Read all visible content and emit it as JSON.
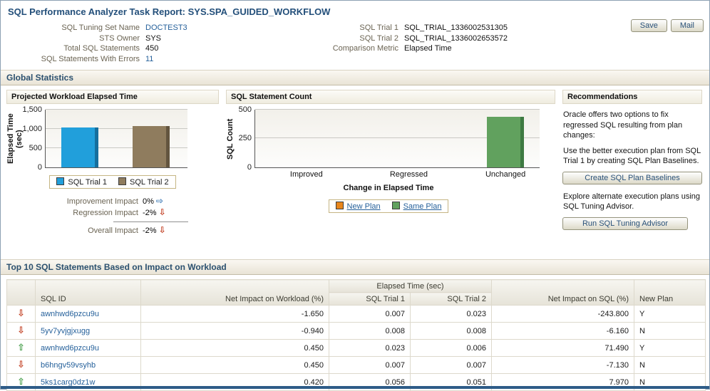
{
  "page": {
    "title": "SQL Performance Analyzer Task Report: SYS.SPA_GUIDED_WORKFLOW"
  },
  "toolbar": {
    "save": "Save",
    "mail": "Mail"
  },
  "summary": {
    "left": [
      {
        "label": "SQL Tuning Set Name",
        "value": "DOCTEST3"
      },
      {
        "label": "STS Owner",
        "value": "SYS"
      },
      {
        "label": "Total SQL Statements",
        "value": "450"
      },
      {
        "label": "SQL Statements With Errors",
        "value": "11"
      }
    ],
    "right": [
      {
        "label": "SQL Trial 1",
        "value": "SQL_TRIAL_1336002531305"
      },
      {
        "label": "SQL Trial 2",
        "value": "SQL_TRIAL_1336002653572"
      },
      {
        "label": "Comparison Metric",
        "value": "Elapsed Time"
      }
    ]
  },
  "sections": {
    "global_statistics": "Global Statistics",
    "top_sql": "Top 10 SQL Statements Based on Impact on Workload"
  },
  "chart_data": [
    {
      "type": "bar",
      "title": "Projected Workload Elapsed Time",
      "ylabel": "Elapsed Time (sec)",
      "ylim": [
        0,
        1500
      ],
      "yticks": [
        "0",
        "500",
        "1,000",
        "1,500"
      ],
      "grid": true,
      "legend_position": "bottom",
      "series": [
        {
          "name": "SQL Trial 1",
          "value": 1020,
          "color": "#219fdb"
        },
        {
          "name": "SQL Trial 2",
          "value": 1060,
          "color": "#8f7c5e"
        }
      ]
    },
    {
      "type": "bar",
      "title": "SQL Statement Count",
      "ylabel": "SQL Count",
      "xlabel": "Change in Elapsed Time",
      "ylim": [
        0,
        500
      ],
      "yticks": [
        "0",
        "250",
        "500"
      ],
      "grid": true,
      "legend_position": "bottom",
      "categories": [
        "Improved",
        "Regressed",
        "Unchanged"
      ],
      "series": [
        {
          "name": "New Plan",
          "color": "#e8861c",
          "values": [
            0,
            0,
            0
          ]
        },
        {
          "name": "Same Plan",
          "color": "#61a15e",
          "values": [
            0,
            0,
            430
          ]
        }
      ]
    }
  ],
  "impacts": {
    "rows": [
      {
        "label": "Improvement Impact",
        "value": "0%",
        "direction": "right",
        "glyph": "⇨"
      },
      {
        "label": "Regression Impact",
        "value": "-2%",
        "direction": "down",
        "glyph": "⇩"
      }
    ],
    "overall": {
      "label": "Overall Impact",
      "value": "-2%",
      "direction": "down",
      "glyph": "⇩"
    }
  },
  "recommendations": {
    "title": "Recommendations",
    "intro": "Oracle offers two options to fix regressed SQL resulting from plan changes:",
    "option1_text": "Use the better execution plan from SQL Trial 1 by creating SQL Plan Baselines.",
    "option1_button": "Create SQL Plan Baselines",
    "option2_text": "Explore alternate execution plans using SQL Tuning Advisor.",
    "option2_button": "Run SQL Tuning Advisor"
  },
  "table": {
    "group_header": "Elapsed Time (sec)",
    "columns": {
      "sql_id": "SQL ID",
      "net_impact_workload": "Net Impact on Workload (%)",
      "trial1": "SQL Trial 1",
      "trial2": "SQL Trial 2",
      "net_impact_sql": "Net Impact on SQL (%)",
      "new_plan": "New Plan"
    },
    "rows": [
      {
        "trend": "down",
        "glyph": "⇩",
        "sql_id": "awnhwd6pzcu9u",
        "net_impact_workload": "-1.650",
        "trial1": "0.007",
        "trial2": "0.023",
        "net_impact_sql": "-243.800",
        "new_plan": "Y"
      },
      {
        "trend": "down",
        "glyph": "⇩",
        "sql_id": "5yv7yvjgjxugg",
        "net_impact_workload": "-0.940",
        "trial1": "0.008",
        "trial2": "0.008",
        "net_impact_sql": "-6.160",
        "new_plan": "N"
      },
      {
        "trend": "up",
        "glyph": "⇧",
        "sql_id": "awnhwd6pzcu9u",
        "net_impact_workload": "0.450",
        "trial1": "0.023",
        "trial2": "0.006",
        "net_impact_sql": "71.490",
        "new_plan": "Y"
      },
      {
        "trend": "down",
        "glyph": "⇩",
        "sql_id": "b6hngv59vsyhb",
        "net_impact_workload": "0.450",
        "trial1": "0.007",
        "trial2": "0.007",
        "net_impact_sql": "-7.130",
        "new_plan": "N"
      },
      {
        "trend": "up",
        "glyph": "⇧",
        "sql_id": "5ks1carg0dz1w",
        "net_impact_workload": "0.420",
        "trial1": "0.056",
        "trial2": "0.051",
        "net_impact_sql": "7.970",
        "new_plan": "N"
      }
    ]
  },
  "colors": {
    "trial1_bar": "#219fdb",
    "trial2_bar": "#8f7c5e",
    "new_plan_swatch": "#e8861c",
    "same_plan_bar": "#61a15e",
    "regression_red": "#c0391b",
    "improvement_green": "#3f9a44",
    "link_blue": "#26619b"
  }
}
